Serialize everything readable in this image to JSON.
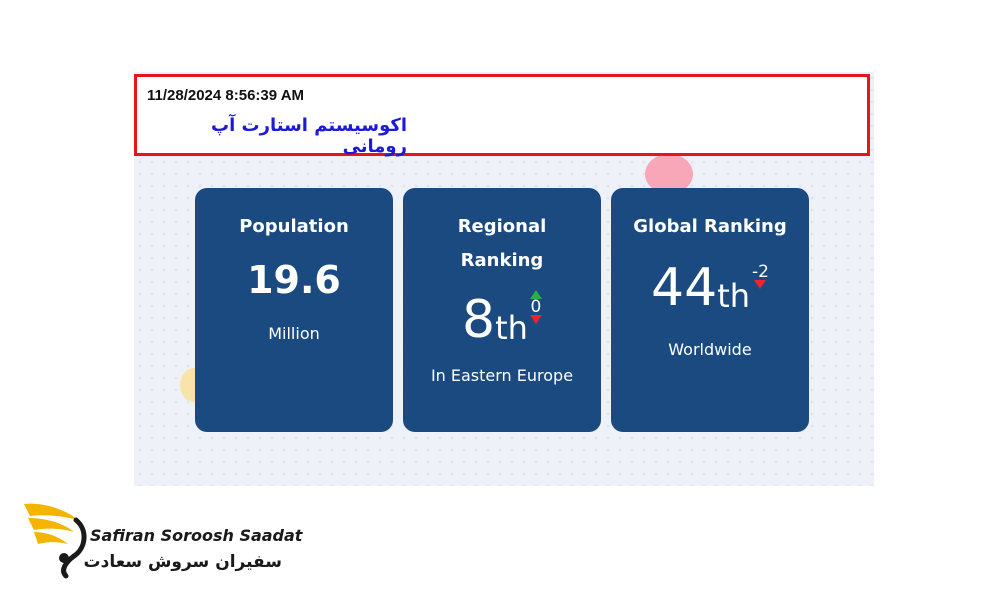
{
  "header": {
    "datetime": "11/28/2024 8:56:39 AM",
    "subtitle": "اکوسیستم استارت آپ رومانی"
  },
  "cards": [
    {
      "title": "Population",
      "value": "19.6",
      "caption": "Million"
    },
    {
      "title_line1": "Regional",
      "title_line2": "Ranking",
      "rank": "8",
      "suffix": "th",
      "change": "0",
      "caption": "In Eastern Europe"
    },
    {
      "title": "Global Ranking",
      "rank": "44",
      "suffix": "th",
      "change": "-2",
      "caption": "Worldwide"
    }
  ],
  "logo": {
    "name_en": "Safiran Soroosh Saadat",
    "name_fa": "سفیران سروش سعادت",
    "icon": "bird-logo-icon"
  },
  "colors": {
    "card_bg": "#1a4a80",
    "header_border": "#e8141c",
    "subtitle": "#1d1ad6",
    "up": "#25b048",
    "down": "#ee2230",
    "logo_gold": "#f4b400"
  }
}
